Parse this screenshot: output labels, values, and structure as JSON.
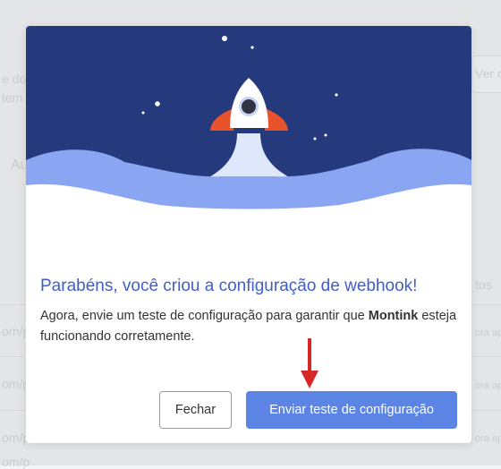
{
  "background": {
    "fragments": [
      "e do",
      "tem",
      "Au",
      "tos",
      "Ver c",
      "om/p",
      "om/p",
      "om/p",
      "om/p",
      "ora ap",
      "ora ap",
      "ora ap"
    ]
  },
  "modal": {
    "title": "Parabéns, você criou a configuração de webhook!",
    "description_before": "Agora, envie um teste de configuração para garantir que ",
    "description_bold": "Montink",
    "description_after": " esteja funcionando corretamente.",
    "close_button": "Fechar",
    "primary_button": "Enviar teste de configuração"
  },
  "colors": {
    "hero_sky": "#253a7d",
    "cloud": "#8aa6f2",
    "title": "#3f5fc4",
    "primary": "#5b84e4",
    "arrow": "#d62626",
    "rocket_fins": "#e8532b"
  },
  "icons": [
    "rocket-icon",
    "star-icon",
    "red-arrow-annotation"
  ]
}
